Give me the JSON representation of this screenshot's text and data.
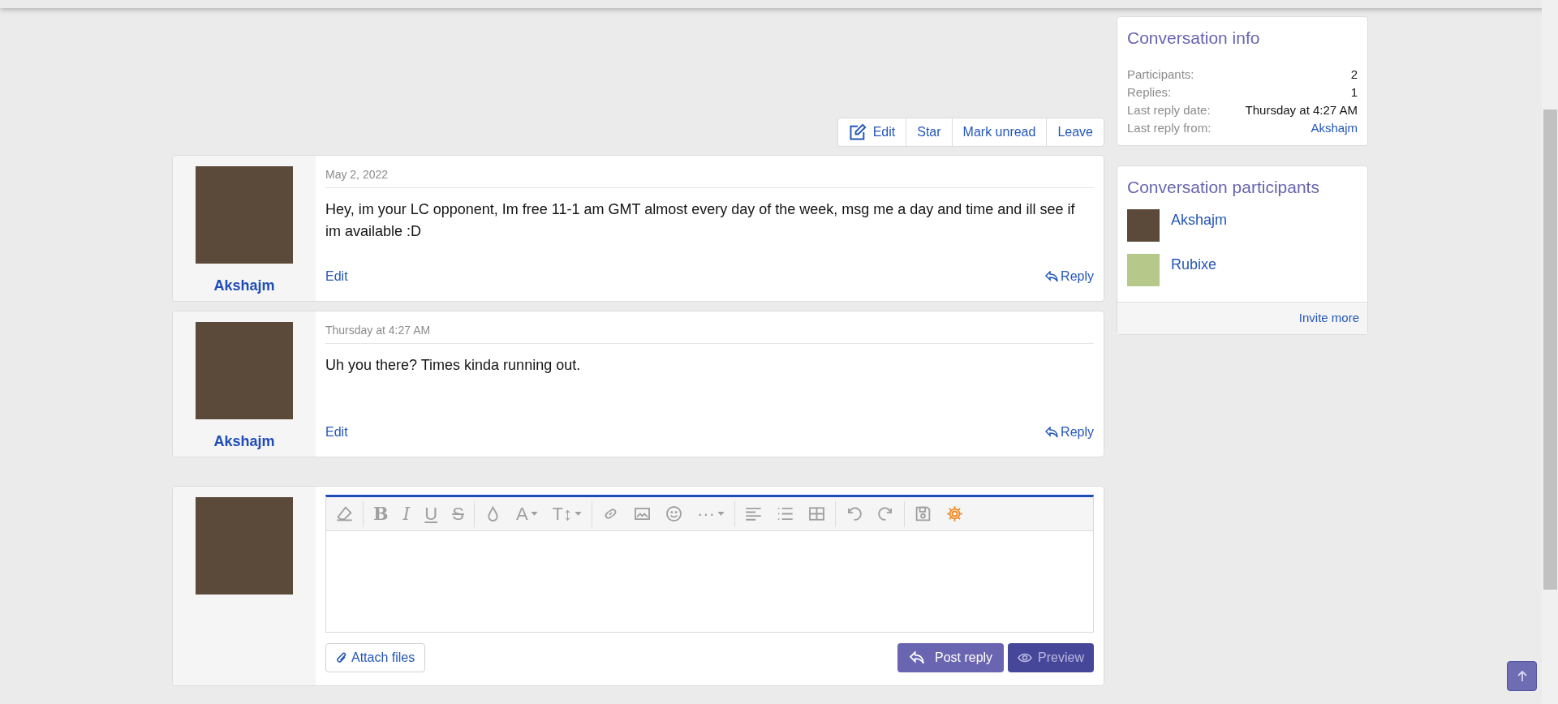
{
  "actions": [
    {
      "label": "Edit",
      "icon": true
    },
    {
      "label": "Star",
      "icon": false
    },
    {
      "label": "Mark unread",
      "icon": false
    },
    {
      "label": "Leave",
      "icon": false
    }
  ],
  "messages": [
    {
      "author": "Akshajm",
      "date": "May 2, 2022",
      "body": "Hey, im your LC opponent, Im free 11-1 am GMT almost every day of the week, msg me a day and time and ill see if im available :D",
      "edit": "Edit",
      "reply": "Reply"
    },
    {
      "author": "Akshajm",
      "date": "Thursday at 4:27 AM",
      "body": "Uh you there? Times kinda running out.",
      "edit": "Edit",
      "reply": "Reply"
    }
  ],
  "editor": {
    "glyphs": [
      "B",
      "I",
      "U",
      "S",
      "A",
      "T↕",
      "···"
    ],
    "attach": "Attach files",
    "post": "Post reply",
    "preview": "Preview"
  },
  "sidebar": {
    "info": {
      "title": "Conversation info",
      "rows": [
        {
          "label": "Participants:",
          "value": "2",
          "kind": "text"
        },
        {
          "label": "Replies:",
          "value": "1",
          "kind": "text"
        },
        {
          "label": "Last reply date:",
          "value": "Thursday at 4:27 AM",
          "kind": "text"
        },
        {
          "label": "Last reply from:",
          "value": "Akshajm",
          "kind": "link"
        }
      ]
    },
    "participants": {
      "title": "Conversation participants",
      "items": [
        {
          "name": "Akshajm",
          "color": "#5b4a3a"
        },
        {
          "name": "Rubixe",
          "color": "#b7c98a"
        }
      ],
      "footer": "Invite more"
    }
  }
}
